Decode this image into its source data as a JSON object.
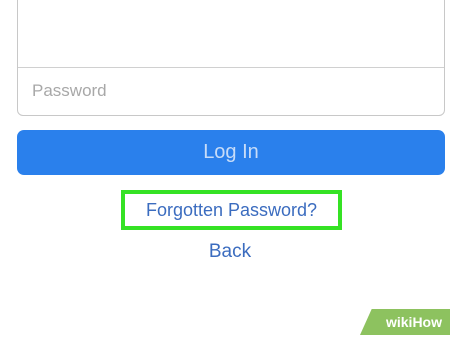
{
  "login": {
    "email_value": "",
    "password_placeholder": "Password",
    "login_button_label": "Log In",
    "forgot_password_label": "Forgotten Password?",
    "back_label": "Back"
  },
  "watermark": {
    "prefix": "wiki",
    "suffix": "How"
  },
  "colors": {
    "login_button": "#2a80ec",
    "link": "#3b6cbf",
    "highlight": "#35e224",
    "watermark_bg": "#8dc25f"
  }
}
